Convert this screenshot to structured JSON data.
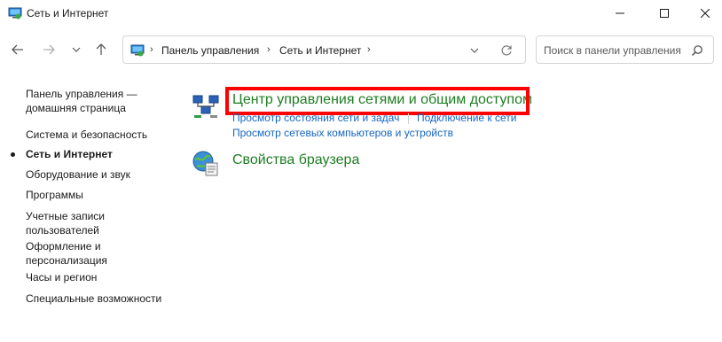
{
  "window": {
    "title": "Сеть и Интернет"
  },
  "address_bar": {
    "crumbs": [
      "Панель управления",
      "Сеть и Интернет"
    ]
  },
  "search": {
    "placeholder": "Поиск в панели управления"
  },
  "sidebar": {
    "items": [
      {
        "label_lines": [
          "Панель управления —",
          "домашняя страница"
        ]
      },
      {
        "label": "Система и безопасность"
      },
      {
        "label": "Сеть и Интернет",
        "active": true
      },
      {
        "label": "Оборудование и звук"
      },
      {
        "label": "Программы"
      },
      {
        "label_lines": [
          "Учетные записи",
          "пользователей"
        ]
      },
      {
        "label_lines": [
          "Оформление и",
          "персонализация"
        ]
      },
      {
        "label": "Часы и регион"
      },
      {
        "label": "Специальные возможности"
      }
    ]
  },
  "main": {
    "categories": [
      {
        "title": "Центр управления сетями и общим доступом",
        "links": [
          "Просмотр состояния сети и задач",
          "Подключение к сети",
          "Просмотр сетевых компьютеров и устройств"
        ],
        "highlighted": true
      },
      {
        "title": "Свойства браузера",
        "links": []
      }
    ]
  },
  "colors": {
    "category_title": "#1e7d22",
    "link": "#1565c0",
    "highlight_border": "#ff0000"
  }
}
